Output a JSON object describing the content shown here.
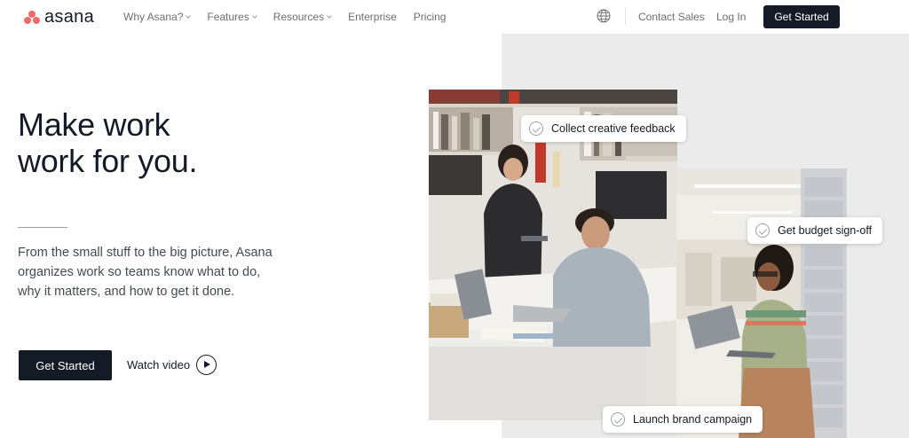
{
  "brand": {
    "name": "asana",
    "color": "#f06a6a"
  },
  "nav": {
    "links": [
      {
        "label": "Why Asana?",
        "dropdown": true
      },
      {
        "label": "Features",
        "dropdown": true
      },
      {
        "label": "Resources",
        "dropdown": true
      },
      {
        "label": "Enterprise",
        "dropdown": false
      },
      {
        "label": "Pricing",
        "dropdown": false
      }
    ],
    "globe_icon": "globe-icon",
    "contact_sales": "Contact Sales",
    "log_in": "Log In",
    "get_started": "Get Started"
  },
  "hero": {
    "headline_line1": "Make work",
    "headline_line2": "work for you.",
    "subtext": "From the small stuff to the big picture, Asana organizes work so teams know what to do, why it matters, and how to get it done.",
    "cta_label": "Get Started",
    "watch_label": "Watch video",
    "watch_icon": "play-icon"
  },
  "cards": [
    {
      "label": "Collect creative feedback",
      "icon": "check-circle-icon"
    },
    {
      "label": "Get budget sign-off",
      "icon": "check-circle-icon"
    },
    {
      "label": "Launch brand campaign",
      "icon": "check-circle-icon"
    }
  ],
  "colors": {
    "dark": "#151b26",
    "panel": "#ebebeb",
    "body_text": "#444a52",
    "nav_text": "#6d6e6f"
  }
}
